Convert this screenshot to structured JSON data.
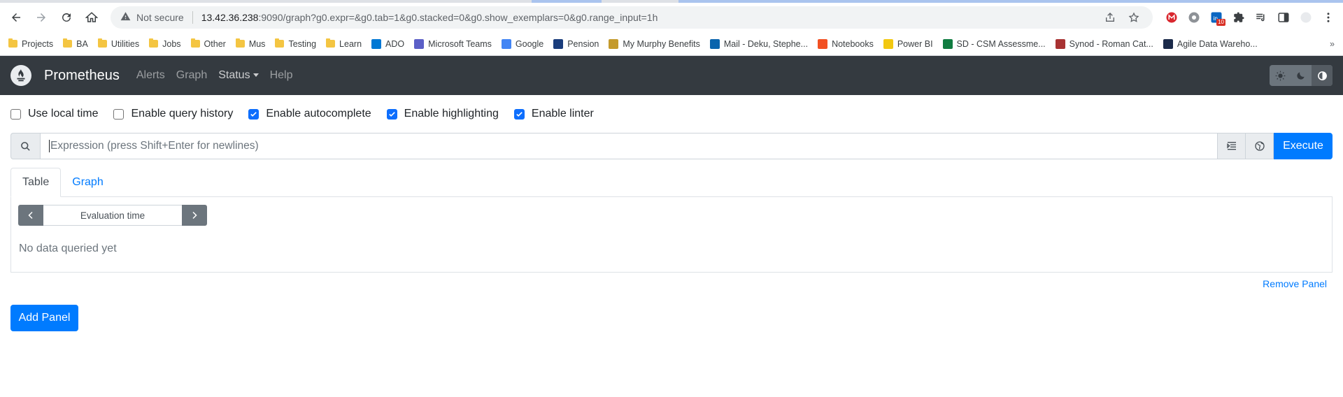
{
  "browser": {
    "address": {
      "security_label": "Not secure",
      "url_host": "13.42.36.238",
      "url_rest": ":9090/graph?g0.expr=&g0.tab=1&g0.stacked=0&g0.show_exemplars=0&g0.range_input=1h"
    },
    "extension_badge": "10",
    "bookmarks": [
      {
        "label": "Projects",
        "icon": "folder-icon"
      },
      {
        "label": "BA",
        "icon": "folder-icon"
      },
      {
        "label": "Utilities",
        "icon": "folder-icon"
      },
      {
        "label": "Jobs",
        "icon": "folder-icon"
      },
      {
        "label": "Other",
        "icon": "folder-icon"
      },
      {
        "label": "Mus",
        "icon": "folder-icon"
      },
      {
        "label": "Testing",
        "icon": "folder-icon"
      },
      {
        "label": "Learn",
        "icon": "folder-icon"
      },
      {
        "label": "ADO",
        "icon": "ado-icon",
        "color": "#0078d4"
      },
      {
        "label": "Microsoft Teams",
        "icon": "teams-icon",
        "color": "#5b5fc7"
      },
      {
        "label": "Google",
        "icon": "google-icon",
        "color": "#4285f4"
      },
      {
        "label": "Pension",
        "icon": "pension-icon",
        "color": "#1a3d7c"
      },
      {
        "label": "My Murphy Benefits",
        "icon": "benefits-icon",
        "color": "#c49a2c"
      },
      {
        "label": "Mail - Deku, Stephe...",
        "icon": "outlook-icon",
        "color": "#0a64ad"
      },
      {
        "label": "Notebooks",
        "icon": "microsoft-icon",
        "color": "#f25022"
      },
      {
        "label": "Power BI",
        "icon": "powerbi-icon",
        "color": "#f2c811"
      },
      {
        "label": "SD - CSM Assessme...",
        "icon": "excel-icon",
        "color": "#107c41"
      },
      {
        "label": "Synod - Roman Cat...",
        "icon": "shield-icon",
        "color": "#a83232"
      },
      {
        "label": "Agile Data Wareho...",
        "icon": "adw-icon",
        "color": "#1b2a4a"
      }
    ]
  },
  "prometheus": {
    "brand": "Prometheus",
    "nav": [
      "Alerts",
      "Graph",
      "Status",
      "Help"
    ],
    "options": [
      {
        "label": "Use local time",
        "checked": false
      },
      {
        "label": "Enable query history",
        "checked": false
      },
      {
        "label": "Enable autocomplete",
        "checked": true
      },
      {
        "label": "Enable highlighting",
        "checked": true
      },
      {
        "label": "Enable linter",
        "checked": true
      }
    ],
    "expression": {
      "placeholder": "Expression (press Shift+Enter for newlines)",
      "execute_label": "Execute"
    },
    "tabs": [
      "Table",
      "Graph"
    ],
    "eval_time_placeholder": "Evaluation time",
    "no_data": "No data queried yet",
    "remove_panel": "Remove Panel",
    "add_panel": "Add Panel"
  },
  "colors": {
    "primary": "#007bff",
    "navbar": "#343a40",
    "secondary": "#6c757d"
  }
}
